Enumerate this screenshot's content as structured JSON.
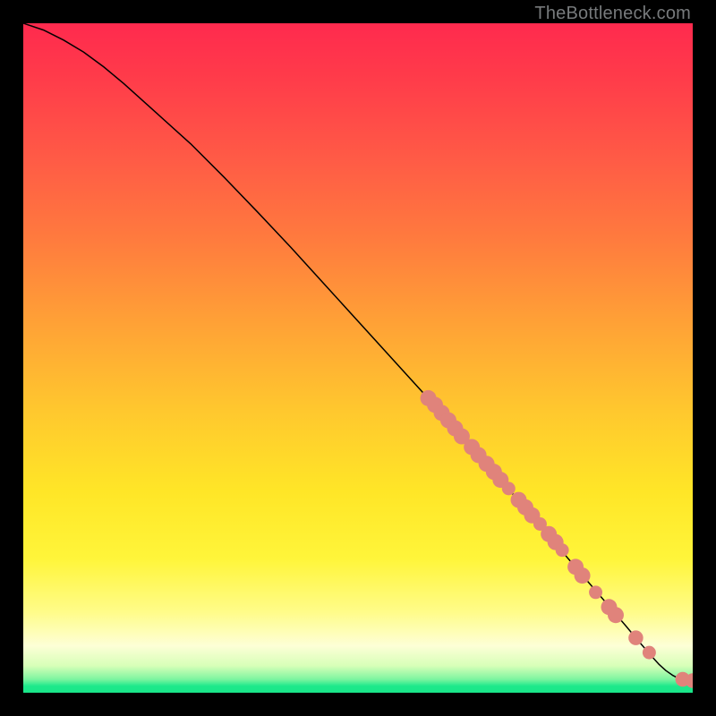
{
  "watermark": {
    "text": "TheBottleneck.com"
  },
  "colors": {
    "dot": "#e0837b",
    "line": "#000000"
  },
  "chart_data": {
    "type": "line",
    "title": "",
    "xlabel": "",
    "ylabel": "",
    "xlim": [
      0,
      100
    ],
    "ylim": [
      0,
      100
    ],
    "grid": false,
    "series": [
      {
        "name": "curve",
        "kind": "line",
        "x": [
          0,
          3,
          6,
          9,
          12,
          15,
          20,
          25,
          30,
          35,
          40,
          45,
          50,
          55,
          60,
          63,
          66,
          69,
          72,
          75,
          78,
          81,
          84,
          87,
          90,
          92,
          94,
          95,
          96,
          97,
          98,
          99,
          100
        ],
        "y": [
          100,
          99,
          97.5,
          95.7,
          93.5,
          91,
          86.5,
          82,
          77,
          71.8,
          66.5,
          61,
          55.5,
          50,
          44.5,
          41.2,
          37.8,
          34.5,
          31,
          27.5,
          24,
          20.5,
          17,
          13.5,
          10,
          7.6,
          5.3,
          4.2,
          3.3,
          2.6,
          2.1,
          1.9,
          1.8
        ]
      },
      {
        "name": "dots",
        "kind": "scatter",
        "points": [
          {
            "x": 60.5,
            "y": 44.0,
            "r": 1.2
          },
          {
            "x": 61.5,
            "y": 43.0,
            "r": 1.2
          },
          {
            "x": 62.5,
            "y": 41.8,
            "r": 1.2
          },
          {
            "x": 63.5,
            "y": 40.7,
            "r": 1.2
          },
          {
            "x": 64.5,
            "y": 39.5,
            "r": 1.2
          },
          {
            "x": 65.5,
            "y": 38.3,
            "r": 1.2
          },
          {
            "x": 67.0,
            "y": 36.7,
            "r": 1.2
          },
          {
            "x": 68.0,
            "y": 35.5,
            "r": 1.2
          },
          {
            "x": 69.2,
            "y": 34.2,
            "r": 1.2
          },
          {
            "x": 70.3,
            "y": 33.0,
            "r": 1.2
          },
          {
            "x": 71.3,
            "y": 31.8,
            "r": 1.2
          },
          {
            "x": 72.5,
            "y": 30.5,
            "r": 1.0
          },
          {
            "x": 74.0,
            "y": 28.8,
            "r": 1.2
          },
          {
            "x": 75.0,
            "y": 27.7,
            "r": 1.2
          },
          {
            "x": 76.0,
            "y": 26.5,
            "r": 1.2
          },
          {
            "x": 77.2,
            "y": 25.2,
            "r": 1.0
          },
          {
            "x": 78.5,
            "y": 23.7,
            "r": 1.2
          },
          {
            "x": 79.5,
            "y": 22.5,
            "r": 1.2
          },
          {
            "x": 80.5,
            "y": 21.3,
            "r": 1.0
          },
          {
            "x": 82.5,
            "y": 18.8,
            "r": 1.2
          },
          {
            "x": 83.5,
            "y": 17.5,
            "r": 1.2
          },
          {
            "x": 85.5,
            "y": 15.0,
            "r": 1.0
          },
          {
            "x": 87.5,
            "y": 12.8,
            "r": 1.2
          },
          {
            "x": 88.5,
            "y": 11.6,
            "r": 1.2
          },
          {
            "x": 91.5,
            "y": 8.2,
            "r": 1.1
          },
          {
            "x": 93.5,
            "y": 6.0,
            "r": 1.0
          },
          {
            "x": 98.5,
            "y": 2.0,
            "r": 1.1
          },
          {
            "x": 100.0,
            "y": 1.8,
            "r": 1.1
          }
        ]
      }
    ]
  }
}
